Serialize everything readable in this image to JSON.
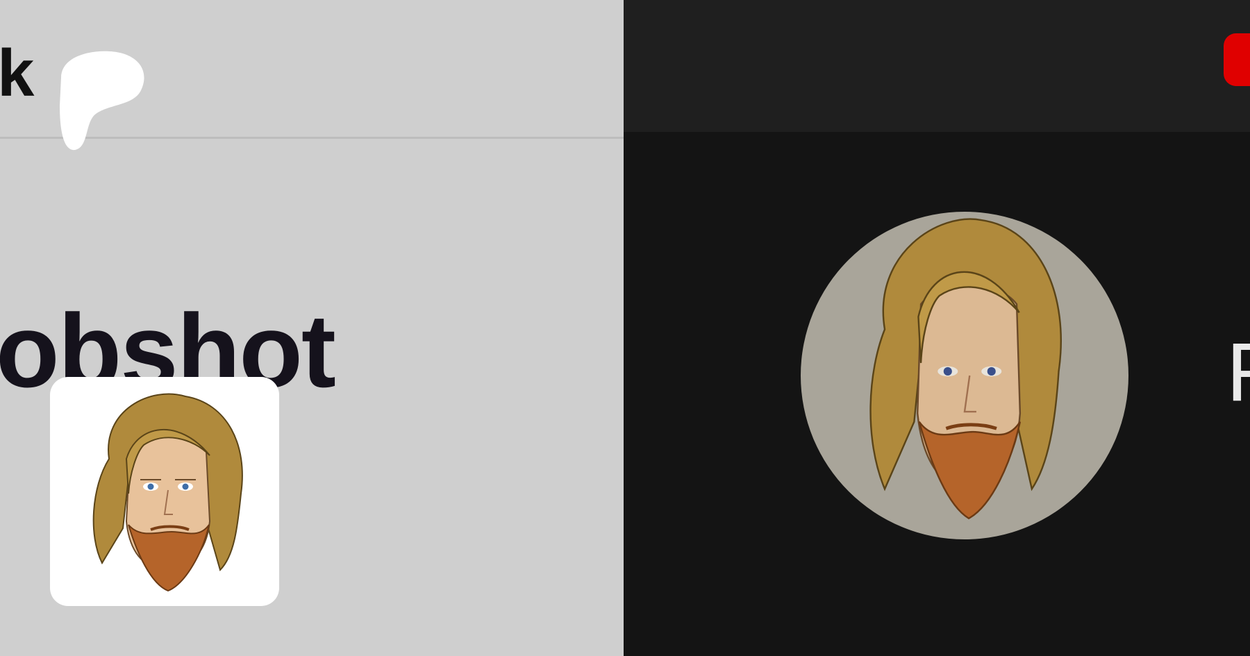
{
  "left_pane": {
    "brand_partial": "k",
    "profile_title_partial": "obshot",
    "avatar_alt": "bearded-man-cartoon-avatar"
  },
  "right_pane": {
    "channel_name_partial": "R",
    "logo_icon": "youtube-logo-icon",
    "avatar_alt": "bearded-man-cartoon-avatar"
  },
  "colors": {
    "left_bg": "#cfcfcf",
    "right_bg": "#141414",
    "right_topbar": "#1f1f1f",
    "youtube_red": "#e00000",
    "hair": "#b08a3c",
    "beard": "#b5642a",
    "skin": "#e8c29b"
  }
}
